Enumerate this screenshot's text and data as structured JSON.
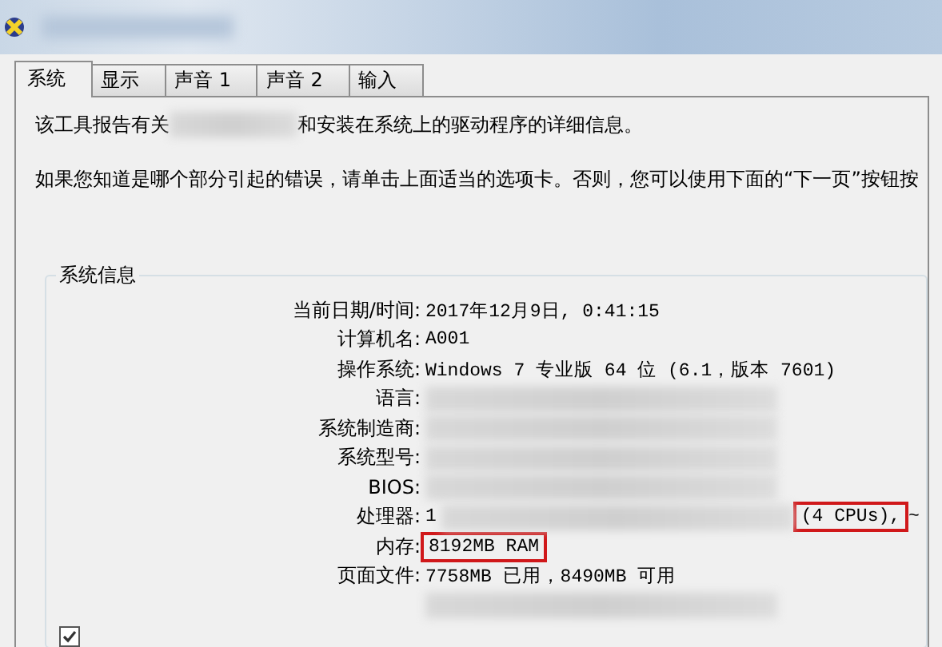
{
  "tabs": [
    {
      "label": "系统",
      "selected": true
    },
    {
      "label": "显示",
      "selected": false
    },
    {
      "label": "声音 1",
      "selected": false
    },
    {
      "label": "声音 2",
      "selected": false
    },
    {
      "label": "输入",
      "selected": false
    }
  ],
  "intro": [
    {
      "segments": [
        {
          "kind": "text",
          "text": "该工具报告有关"
        },
        {
          "kind": "redacted"
        },
        {
          "kind": "text",
          "text": "和安装在系统上的驱动程序的详细信息。"
        }
      ]
    },
    {
      "segments": [
        {
          "kind": "text",
          "text": "如果您知道是哪个部分引起的错误，请单击上面适当的选项卡。否则，您可以使用下面的“下一页”按钮按"
        }
      ]
    }
  ],
  "system_info": {
    "title": "系统信息",
    "rows": [
      {
        "label": "当前日期/时间:",
        "segments": [
          {
            "kind": "text",
            "text": "2017年12月9日, 0:41:15",
            "highlighted": false
          }
        ]
      },
      {
        "label": "计算机名:",
        "segments": [
          {
            "kind": "text",
            "text": "A001",
            "highlighted": false
          }
        ]
      },
      {
        "label": "操作系统:",
        "segments": [
          {
            "kind": "text",
            "text": "Windows 7 专业版 64 位 (6.1，版本 7601)",
            "highlighted": false
          }
        ]
      },
      {
        "label": "语言:",
        "segments": [
          {
            "kind": "redacted"
          }
        ]
      },
      {
        "label": "系统制造商:",
        "segments": [
          {
            "kind": "redacted"
          }
        ]
      },
      {
        "label": "系统型号:",
        "segments": [
          {
            "kind": "redacted"
          }
        ]
      },
      {
        "label": "BIOS:",
        "segments": [
          {
            "kind": "redacted"
          }
        ]
      },
      {
        "label": "处理器:",
        "segments": [
          {
            "kind": "text",
            "text": "1",
            "highlighted": false
          },
          {
            "kind": "redacted"
          },
          {
            "kind": "text",
            "text": "(4 CPUs),",
            "highlighted": true
          },
          {
            "kind": "text",
            "text": "~",
            "highlighted": false
          }
        ]
      },
      {
        "label": "内存:",
        "segments": [
          {
            "kind": "text",
            "text": "8192MB RAM",
            "highlighted": true
          }
        ]
      },
      {
        "label": "页面文件:",
        "segments": [
          {
            "kind": "text",
            "text": "7758MB 已用，8490MB 可用",
            "highlighted": false
          }
        ]
      },
      {
        "label": "",
        "segments": [
          {
            "kind": "redacted"
          }
        ]
      }
    ]
  },
  "whql_check": {
    "checked": true
  }
}
